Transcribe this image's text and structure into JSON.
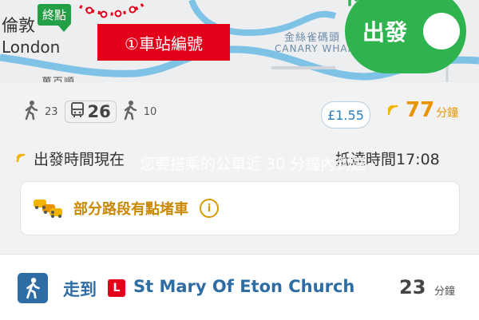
{
  "map": {
    "city_cn": "倫敦",
    "city_en": "London",
    "end_marker": "終點",
    "station_badge": "①車站編號",
    "district_cn": "金絲雀碼頭",
    "district_en": "CANARY WHARF",
    "partial_label": "萬百順"
  },
  "go_button": {
    "label": "出發",
    "icon": "turn-right-arrow-icon"
  },
  "summary": {
    "walk_before_min": "23",
    "bus_number": "26",
    "walk_after_min": "10",
    "fare": "£1.55",
    "duration_value": "77",
    "duration_unit": "分鐘",
    "depart_label": "出發時間現在",
    "arrive_label": "抵達時間17:08",
    "overlay_text": "您要搭乘的公車近 30 分鐘內到達"
  },
  "traffic": {
    "text": "部分路段有點堵車",
    "info_icon": "i"
  },
  "step": {
    "walk_to": "走到",
    "line_badge": "L",
    "stop_name": "St Mary Of Eton Church",
    "duration": "23",
    "unit": "分鐘"
  },
  "colors": {
    "brand_green": "#2fb34f",
    "route_red": "#e3001b",
    "accent_orange": "#e89400",
    "link_blue": "#2e6da4"
  }
}
